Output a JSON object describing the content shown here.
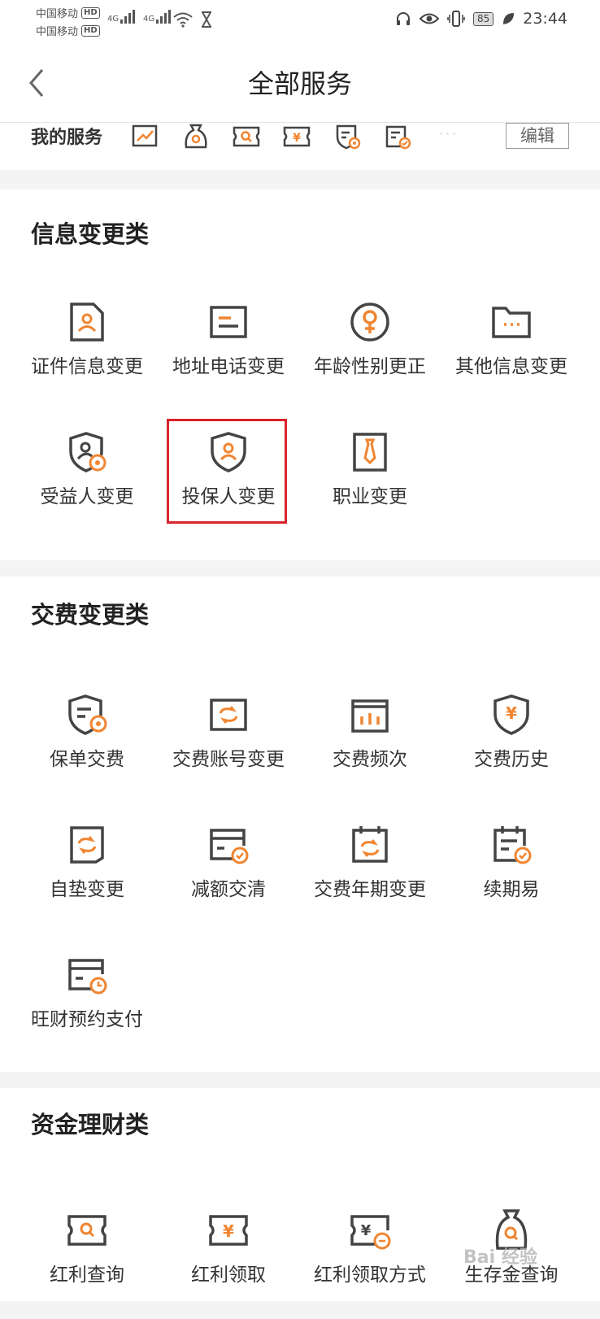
{
  "status_bar": {
    "carrier1": "中国移动",
    "carrier2": "中国移动",
    "hd": "HD",
    "net": "4G",
    "battery": "85",
    "time": "23:44"
  },
  "header": {
    "title": "全部服务"
  },
  "my_services": {
    "label": "我的服务",
    "more": "···",
    "edit": "编辑"
  },
  "sections": [
    {
      "title": "信息变更类",
      "items": [
        "证件信息变更",
        "地址电话变更",
        "年龄性别更正",
        "其他信息变更",
        "受益人变更",
        "投保人变更",
        "职业变更"
      ]
    },
    {
      "title": "交费变更类",
      "items": [
        "保单交费",
        "交费账号变更",
        "交费频次",
        "交费历史",
        "自垫变更",
        "减额交清",
        "交费年期变更",
        "续期易",
        "旺财预约支付"
      ]
    },
    {
      "title": "资金理财类",
      "items": [
        "红利查询",
        "红利领取",
        "红利领取方式",
        "生存金查询"
      ]
    }
  ],
  "icons": {
    "section1": [
      "id-card-icon",
      "address-phone-icon",
      "gender-icon",
      "folder-icon",
      "beneficiary-icon",
      "policyholder-icon",
      "occupation-icon"
    ],
    "section2": [
      "policy-payment-icon",
      "account-change-icon",
      "frequency-icon",
      "payment-history-icon",
      "advance-change-icon",
      "reduced-paidup-icon",
      "term-change-icon",
      "renewal-icon",
      "schedule-payment-icon"
    ],
    "section3": [
      "dividend-query-icon",
      "dividend-claim-icon",
      "dividend-method-icon",
      "survival-benefit-icon"
    ]
  },
  "colors": {
    "accent": "#f08531",
    "icon_dark": "#444444",
    "highlight": "#d8242a"
  },
  "watermark": "Bai 经验"
}
